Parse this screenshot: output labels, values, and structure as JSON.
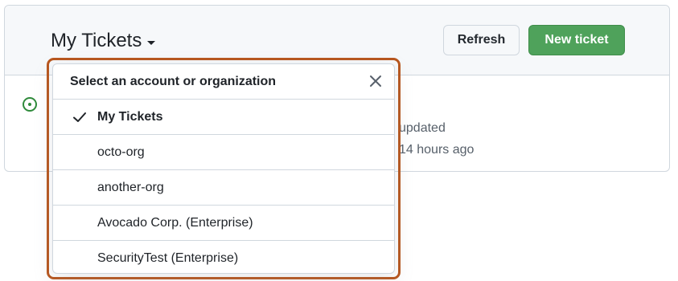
{
  "header": {
    "title": "My Tickets",
    "refresh_label": "Refresh",
    "new_ticket_label": "New ticket"
  },
  "ticket": {
    "meta_line1": "updated",
    "meta_line2": "14 hours ago"
  },
  "dropdown": {
    "title": "Select an account or organization",
    "items": [
      {
        "label": "My Tickets",
        "selected": true
      },
      {
        "label": "octo-org",
        "selected": false
      },
      {
        "label": "another-org",
        "selected": false
      },
      {
        "label": "Avocado Corp. (Enterprise)",
        "selected": false
      },
      {
        "label": "SecurityTest (Enterprise)",
        "selected": false
      }
    ]
  },
  "icons": {
    "status": "issue-open-icon",
    "close": "close-icon",
    "check": "check-icon",
    "caret": "caret-down-icon"
  },
  "colors": {
    "primary_button": "#4fa25b",
    "status_icon": "#2f8a3b",
    "highlight_border": "#b8561d"
  }
}
